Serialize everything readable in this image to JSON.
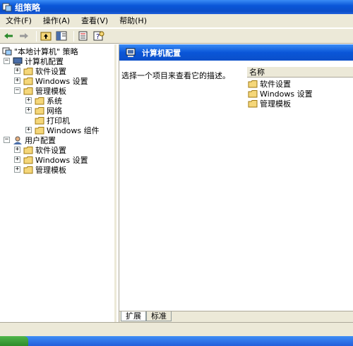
{
  "window": {
    "title": "组策略"
  },
  "menu": [
    "文件(F)",
    "操作(A)",
    "查看(V)",
    "帮助(H)"
  ],
  "toolbar": {
    "buttons": [
      "back-icon",
      "forward-icon",
      "up-folder-icon",
      "show-tree-icon",
      "properties-icon",
      "help-icon"
    ]
  },
  "tree": {
    "root": "\"本地计算机\" 策略",
    "computer": "计算机配置",
    "computer_children": [
      "软件设置",
      "Windows 设置",
      "管理模板"
    ],
    "admin_children": [
      "系统",
      "网络",
      "打印机",
      "Windows 组件"
    ],
    "user": "用户配置",
    "user_children": [
      "软件设置",
      "Windows 设置",
      "管理模板"
    ]
  },
  "right": {
    "header": "计算机配置",
    "description": "选择一个项目来查看它的描述。",
    "column": "名称",
    "items": [
      "软件设置",
      "Windows 设置",
      "管理模板"
    ]
  },
  "tabs": [
    "扩展",
    "标准"
  ],
  "colors": {
    "titlebar": "#0a56d8",
    "folder": "#f5d77a",
    "chrome": "#ece9d8"
  }
}
